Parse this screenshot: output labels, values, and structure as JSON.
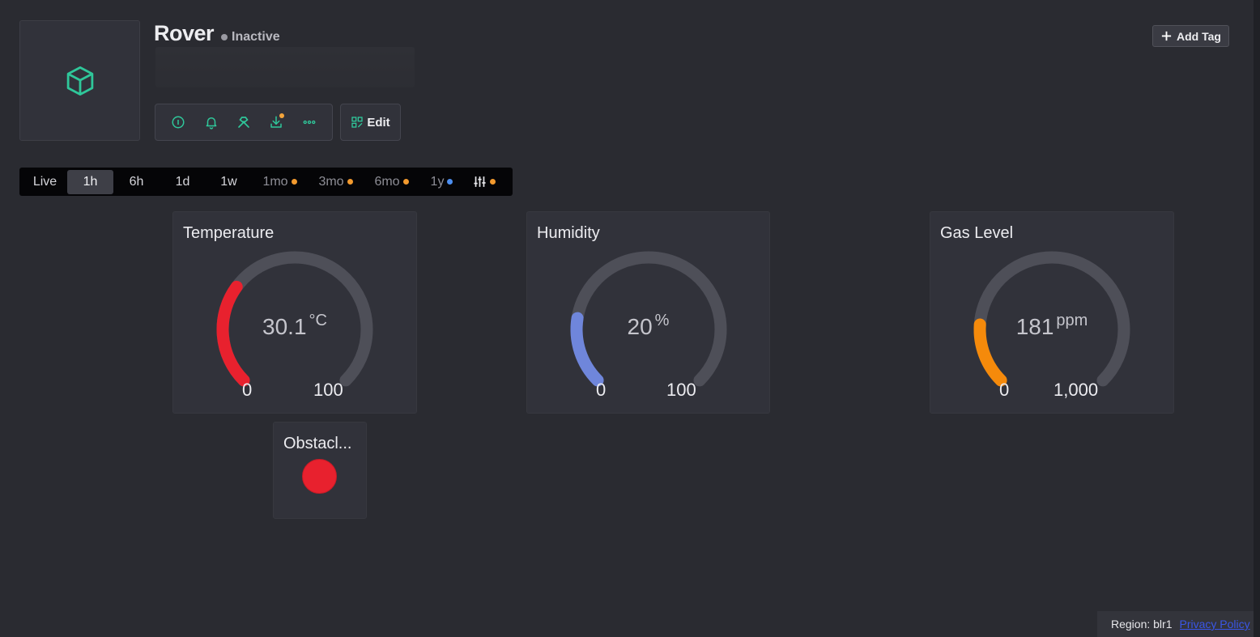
{
  "device": {
    "name": "Rover",
    "status": "Inactive",
    "icon": "cube-icon"
  },
  "actions": {
    "items": [
      {
        "name": "info-icon"
      },
      {
        "name": "bell-icon"
      },
      {
        "name": "tools-icon"
      },
      {
        "name": "download-icon",
        "badge": true
      },
      {
        "name": "more-icon"
      }
    ],
    "edit_label": "Edit",
    "add_tag_label": "Add Tag"
  },
  "time_range": {
    "selected": "1h",
    "options": [
      {
        "label": "Live"
      },
      {
        "label": "1h"
      },
      {
        "label": "6h"
      },
      {
        "label": "1d"
      },
      {
        "label": "1w"
      },
      {
        "label": "1mo",
        "badge": "orange"
      },
      {
        "label": "3mo",
        "badge": "orange"
      },
      {
        "label": "6mo",
        "badge": "orange"
      },
      {
        "label": "1y",
        "badge": "blue"
      }
    ],
    "custom_icon": "sliders-icon"
  },
  "widgets": {
    "temperature": {
      "title": "Temperature",
      "value": "30.1",
      "unit": "°C",
      "min": "0",
      "max": "100",
      "level": 0.301,
      "color": "#e8212e"
    },
    "humidity": {
      "title": "Humidity",
      "value": "20",
      "unit": "%",
      "min": "0",
      "max": "100",
      "level": 0.2,
      "color": "#6f86db"
    },
    "gas": {
      "title": "Gas Level",
      "value": "181",
      "unit": "ppm",
      "min": "0",
      "max": "1,000",
      "level": 0.181,
      "color": "#f58a0b"
    },
    "obstacle": {
      "title": "Obstacl...",
      "color": "#e8212e"
    }
  },
  "footer": {
    "region": "Region: blr1",
    "privacy_link": "Privacy Policy"
  }
}
